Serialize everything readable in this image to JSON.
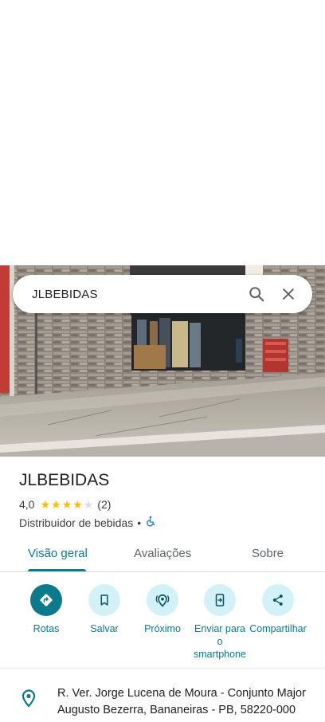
{
  "search": {
    "query": "JLBEBIDAS",
    "search_icon": "search-icon",
    "close_icon": "close-icon"
  },
  "place": {
    "name": "JLBEBIDAS",
    "rating_text": "4,0",
    "rating_value": 4.0,
    "rating_max": 5,
    "review_count": "(2)",
    "category": "Distribuidor de bebidas",
    "separator": "•",
    "accessibility_icon": "wheelchair-icon"
  },
  "tabs": [
    {
      "label": "Visão geral",
      "active": true
    },
    {
      "label": "Avaliações",
      "active": false
    },
    {
      "label": "Sobre",
      "active": false
    }
  ],
  "actions": [
    {
      "label": "Rotas",
      "icon": "directions-icon"
    },
    {
      "label": "Salvar",
      "icon": "bookmark-icon"
    },
    {
      "label": "Próximo",
      "icon": "nearby-icon"
    },
    {
      "label": "Enviar para o smartphone",
      "icon": "send-to-phone-icon"
    },
    {
      "label": "Compartilhar",
      "icon": "share-icon"
    }
  ],
  "address": {
    "text": "R. Ver. Jorge Lucena de Moura - Conjunto Major Augusto Bezerra, Bananeiras - PB, 58220-000",
    "icon": "location-pin-icon"
  },
  "colors": {
    "accent": "#0b7a8a",
    "accent_light": "#d2f2f7",
    "star": "#fbbc04",
    "star_empty": "#dadce0",
    "accessibility": "#1a73e8"
  }
}
